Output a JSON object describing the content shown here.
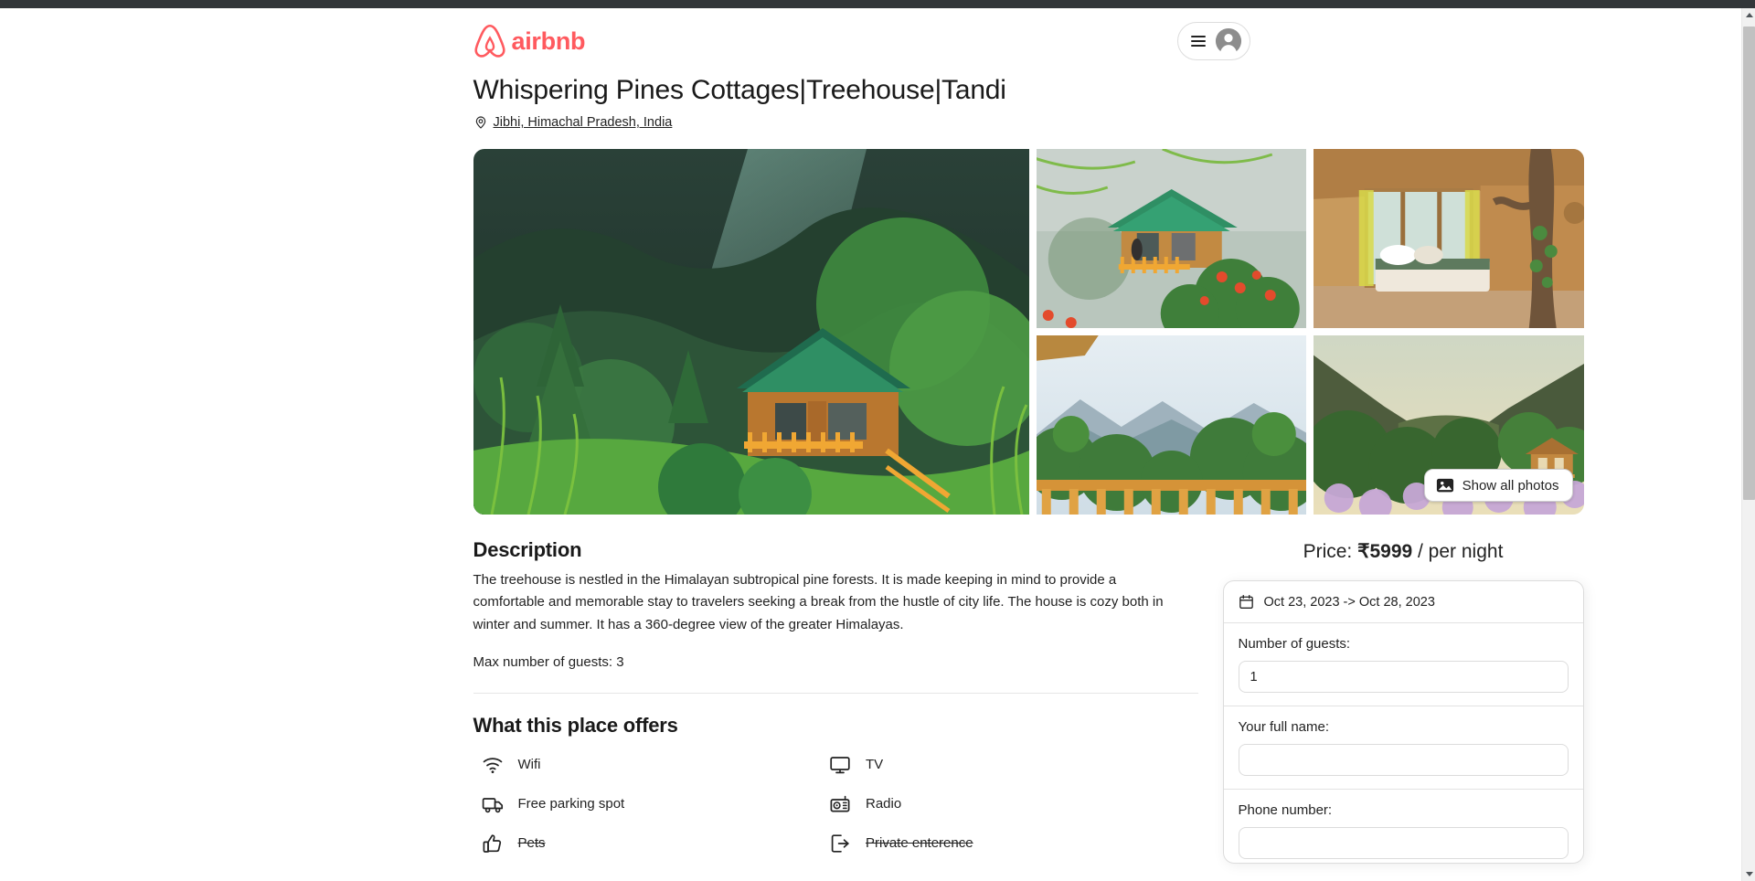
{
  "browser": {
    "scrollbar": {
      "up_arrow": "▲",
      "down_arrow": "▼"
    }
  },
  "header": {
    "brand_name": "airbnb",
    "brand_color": "#ff5a5f",
    "menu_icon": "hamburger-icon",
    "avatar_icon": "user-avatar-icon"
  },
  "listing": {
    "title": "Whispering Pines Cottages|Treehouse|Tandi",
    "location": "Jibhi, Himachal Pradesh, India",
    "location_icon": "map-pin-icon"
  },
  "gallery": {
    "show_all_label": "Show all photos",
    "show_all_icon": "photos-icon",
    "photos": [
      {
        "alt": "Wooden cabin with green roof on forested mountain slope"
      },
      {
        "alt": "Cabin with orange flowers and misty valley backdrop"
      },
      {
        "alt": "Treehouse bedroom interior with tree trunk and large windows"
      },
      {
        "alt": "Mountain valley view over wooden balcony railing"
      },
      {
        "alt": "Cabin in green valley with purple blossoms"
      }
    ]
  },
  "description": {
    "title": "Description",
    "paragraph": "The treehouse is nestled in the Himalayan subtropical pine forests. It is made keeping in mind to provide a comfortable and memorable stay to travelers seeking a break from the hustle of city life. The house is cozy both in winter and summer. It has a 360-degree view of the greater Himalayas.",
    "max_guests": "Max number of guests: 3"
  },
  "amenities": {
    "title": "What this place offers",
    "items": [
      {
        "label": "Wifi",
        "icon": "wifi-icon",
        "available": true
      },
      {
        "label": "TV",
        "icon": "tv-icon",
        "available": true
      },
      {
        "label": "Free parking spot",
        "icon": "parking-truck-icon",
        "available": true
      },
      {
        "label": "Radio",
        "icon": "radio-icon",
        "available": true
      },
      {
        "label": "Pets",
        "icon": "thumbs-up-icon",
        "available": false
      },
      {
        "label": "Private enterence",
        "icon": "private-entrance-icon",
        "available": false
      }
    ]
  },
  "booking": {
    "price_prefix": "Price: ",
    "price_amount": "₹5999",
    "price_suffix": " / per night",
    "date_range": "Oct 23, 2023 -> Oct 28, 2023",
    "date_icon": "calendar-icon",
    "guests_label": "Number of guests:",
    "guests_value": "1",
    "fullname_label": "Your full name:",
    "fullname_value": "",
    "phone_label": "Phone number:",
    "phone_value": ""
  }
}
